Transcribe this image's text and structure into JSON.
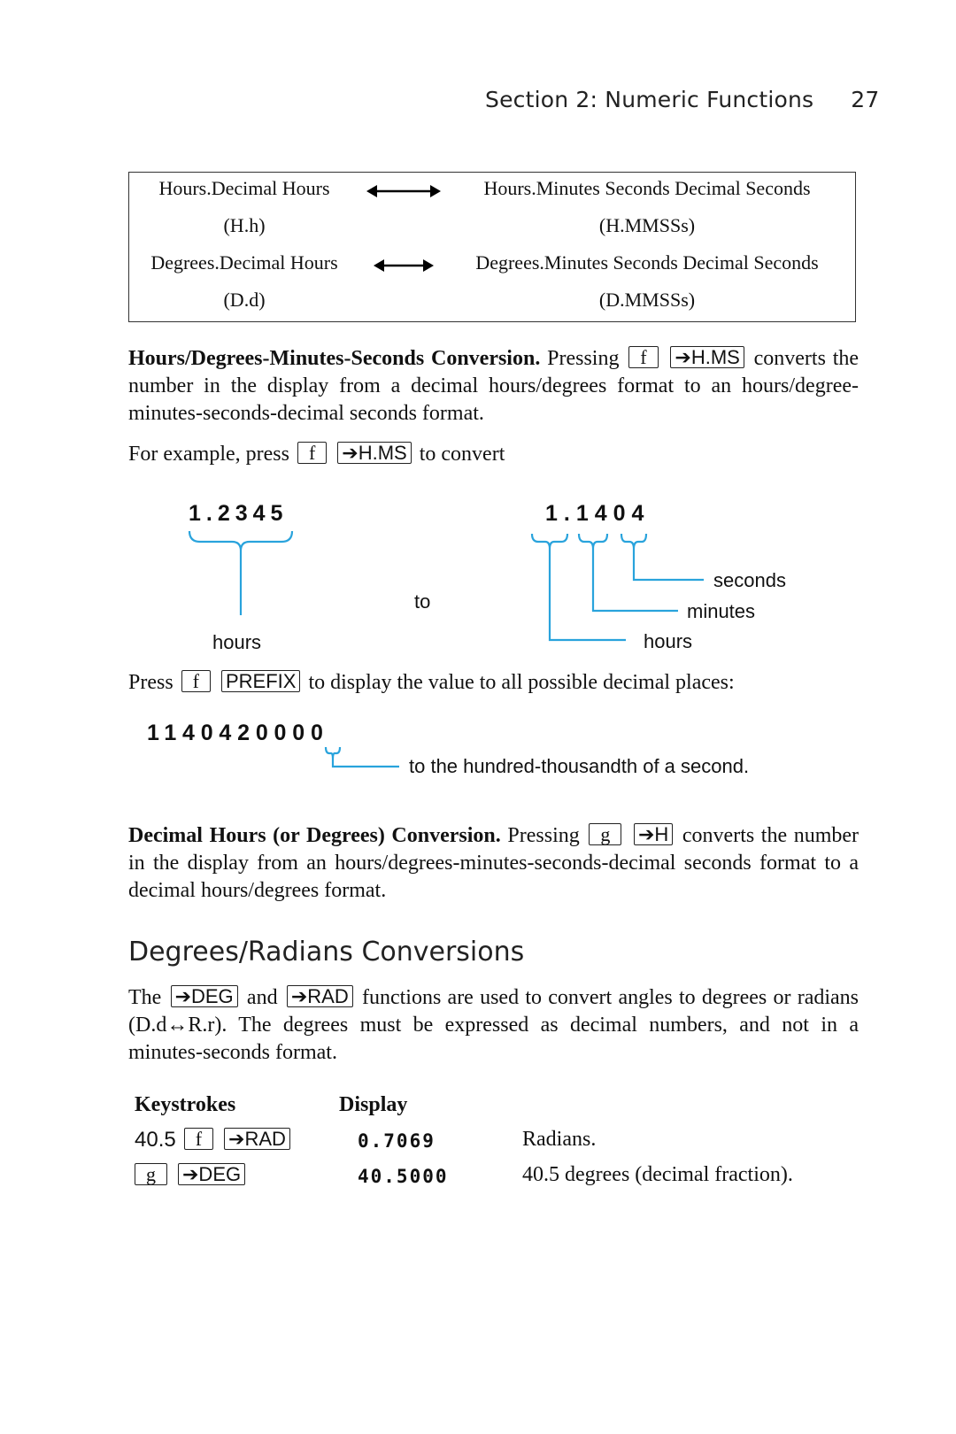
{
  "header": {
    "section": "Section 2: Numeric Functions",
    "page": "27"
  },
  "conversion_table": {
    "rows": [
      {
        "left": "Hours.Decimal Hours",
        "right": "Hours.Minutes Seconds Decimal Seconds"
      },
      {
        "left": "(H.h)",
        "right": "(H.MMSSs)"
      },
      {
        "left": "Degrees.Decimal Hours",
        "right": "Degrees.Minutes Seconds Decimal Seconds"
      },
      {
        "left": "(D.d)",
        "right": "(D.MMSSs)"
      }
    ],
    "arrow_icon": "double-arrow"
  },
  "hms_section": {
    "heading": "Hours/Degrees-Minutes-Seconds Conversion.",
    "text1": "Pressing",
    "key_f": "f",
    "key_hms": "➔H.MS",
    "text2": "converts the number in the display from a decimal hours/degrees format to an hours/degree-minutes-seconds-decimal seconds format."
  },
  "example": {
    "text1": "For example, press",
    "key_f": "f",
    "key_hms": "➔H.MS",
    "text2": "to convert"
  },
  "diagram": {
    "from_value": "1.2345",
    "to_word": "to",
    "to_value": "1.1404",
    "from_label": "hours",
    "to_labels": {
      "seconds": "seconds",
      "minutes": "minutes",
      "hours": "hours"
    },
    "accent_color": "#29a3dc"
  },
  "prefix": {
    "text1": "Press",
    "key_f": "f",
    "key_prefix": "PREFIX",
    "text2": "to display the value to all possible decimal places:",
    "display": "1140420000",
    "annotation": "to the hundred-thousandth of a second."
  },
  "decimal_section": {
    "heading": "Decimal Hours (or Degrees) Conversion.",
    "text1": "Pressing",
    "key_g": "g",
    "key_h": "➔H",
    "text2": "converts the number in the display from an hours/degrees-minutes-seconds-decimal seconds format to a decimal hours/degrees format."
  },
  "deg_rad": {
    "title": "Degrees/Radians Conversions",
    "text1": "The",
    "key_deg": "➔DEG",
    "text_and": "and",
    "key_rad": "➔RAD",
    "text2": "functions are used to convert angles to degrees or radians (D.d↔R.r). The degrees must be expressed as decimal numbers, and not in a minutes-seconds format."
  },
  "keystroke_table": {
    "headers": {
      "keystrokes": "Keystrokes",
      "display": "Display"
    },
    "rows": [
      {
        "prefix": "40.5",
        "keys": [
          "f",
          "➔RAD"
        ],
        "display": "0.7069",
        "note": "Radians."
      },
      {
        "prefix": "",
        "keys": [
          "g",
          "➔DEG"
        ],
        "display": "40.5000",
        "note": "40.5 degrees (decimal fraction)."
      }
    ]
  }
}
